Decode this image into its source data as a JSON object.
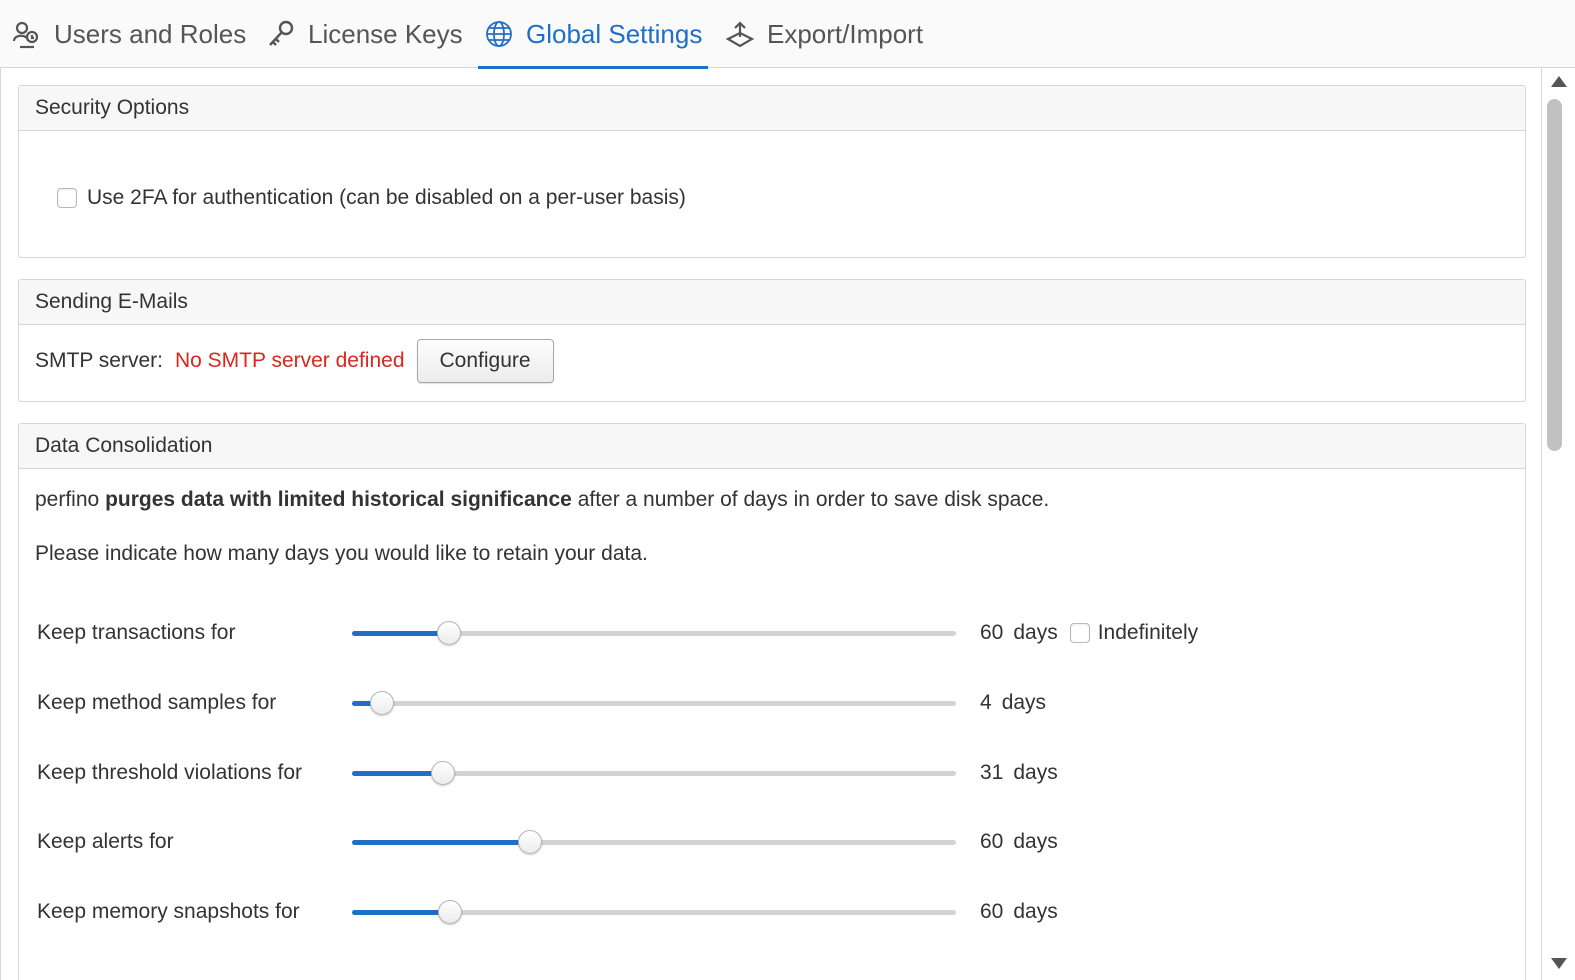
{
  "tabs": [
    {
      "label": "Users and Roles",
      "icon": "users-roles-icon",
      "active": false
    },
    {
      "label": "License Keys",
      "icon": "key-icon",
      "active": false
    },
    {
      "label": "Global Settings",
      "icon": "globe-icon",
      "active": true
    },
    {
      "label": "Export/Import",
      "icon": "export-import-icon",
      "active": false
    }
  ],
  "colors": {
    "accent": "#1f6fc9",
    "error": "#d8281c",
    "text": "#333333"
  },
  "security": {
    "title": "Security Options",
    "twofa_label": "Use 2FA for authentication (can be disabled on a per-user basis)",
    "twofa_checked": false
  },
  "email": {
    "title": "Sending E-Mails",
    "smtp_label": "SMTP server:",
    "smtp_status": "No SMTP server defined",
    "configure_label": "Configure"
  },
  "consolidation": {
    "title": "Data Consolidation",
    "intro_prefix": "perfino",
    "intro_bold": "purges data with limited historical significance",
    "intro_suffix": "after a number of days in order to save disk space.",
    "instruction": "Please indicate how many days you would like to retain your data.",
    "sliders": [
      {
        "label": "Keep transactions for",
        "value": "60",
        "unit": "days",
        "level": 0.16,
        "indefinitely_label": "Indefinitely",
        "indefinitely_checked": false
      },
      {
        "label": "Keep method samples for",
        "value": "4",
        "unit": "days",
        "level": 0.05
      },
      {
        "label": "Keep threshold violations for",
        "value": "31",
        "unit": "days",
        "level": 0.15
      },
      {
        "label": "Keep alerts for",
        "value": "60",
        "unit": "days",
        "level": 0.295
      },
      {
        "label": "Keep memory snapshots for",
        "value": "60",
        "unit": "days",
        "level": 0.162
      }
    ]
  }
}
